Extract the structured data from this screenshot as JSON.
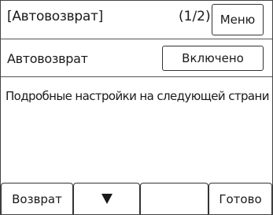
{
  "header": {
    "title": "[Автовозврат]",
    "page_indicator": "(1/2)",
    "menu_label": "Меню"
  },
  "setting": {
    "label": "Автовозврат",
    "value": "Включено"
  },
  "info_text": "Подробные настройки на следующей странице.",
  "footer": {
    "back_label": "Возврат",
    "down_icon": "triangle-down-icon",
    "empty_label": "",
    "done_label": "Готово"
  }
}
